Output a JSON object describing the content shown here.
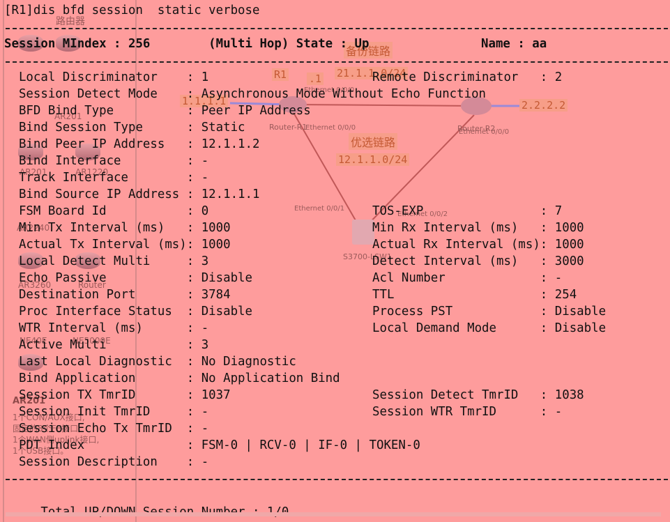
{
  "console": {
    "command_line": "[R1]dis bfd session  static verbose",
    "session_header": {
      "left": "Session MIndex : 256        (Multi Hop) State : Up",
      "right": "Name : aa"
    },
    "rows": [
      {
        "l": "  Local Discriminator    : 1",
        "r": "Remote Discriminator   : 2"
      },
      {
        "l": "  Session Detect Mode    : Asynchronous Mode Without Echo Function",
        "r": ""
      },
      {
        "l": "  BFD Bind Type          : Peer IP Address",
        "r": ""
      },
      {
        "l": "  Bind Session Type      : Static",
        "r": ""
      },
      {
        "l": "  Bind Peer IP Address   : 12.1.1.2",
        "r": ""
      },
      {
        "l": "  Bind Interface         : -",
        "r": ""
      },
      {
        "l": "  Track Interface        : -",
        "r": ""
      },
      {
        "l": "  Bind Source IP Address : 12.1.1.1",
        "r": ""
      },
      {
        "l": "  FSM Board Id           : 0",
        "r": "TOS-EXP                : 7"
      },
      {
        "l": "  Min Tx Interval (ms)   : 1000",
        "r": "Min Rx Interval (ms)   : 1000"
      },
      {
        "l": "  Actual Tx Interval (ms): 1000",
        "r": "Actual Rx Interval (ms): 1000"
      },
      {
        "l": "  Local Detect Multi     : 3",
        "r": "Detect Interval (ms)   : 3000"
      },
      {
        "l": "  Echo Passive           : Disable",
        "r": "Acl Number             : -"
      },
      {
        "l": "  Destination Port       : 3784",
        "r": "TTL                    : 254"
      },
      {
        "l": "  Proc Interface Status  : Disable",
        "r": "Process PST            : Disable"
      },
      {
        "l": "  WTR Interval (ms)      : -",
        "r": "Local Demand Mode      : Disable"
      },
      {
        "l": "  Active Multi           : 3",
        "r": ""
      },
      {
        "l": "  Last Local Diagnostic  : No Diagnostic",
        "r": ""
      },
      {
        "l": "  Bind Application       : No Application Bind",
        "r": ""
      },
      {
        "l": "  Session TX TmrID       : 1037",
        "r": "Session Detect TmrID   : 1038"
      },
      {
        "l": "  Session Init TmrID     : -",
        "r": "Session WTR TmrID      : -"
      },
      {
        "l": "  Session Echo Tx TmrID  : -",
        "r": ""
      },
      {
        "l": "  PDT Index              : FSM-0 | RCV-0 | IF-0 | TOKEN-0",
        "r": ""
      },
      {
        "l": "  Session Description    : -",
        "r": ""
      }
    ],
    "total_line": "     Total UP/DOWN Session Number : 1/0"
  },
  "background": {
    "sidebar_title": "路由器",
    "device_labels": [
      "AR201",
      "AR1220",
      "AR2240",
      "AR3260",
      "Router",
      "NE40E",
      "NE5000E",
      "AR201"
    ],
    "device_desc": [
      "1个CON/AUX接口,",
      "固定的8个FE接口,",
      "1个WAN侧uplink接口,",
      "1个USB接口。"
    ],
    "topology": {
      "link_backup_label": "备份链路",
      "link_preferred_label": "优选链路",
      "router_r1_label": "R1",
      "router_r1_name": "Router-R1",
      "router_r2_name": "Router-R2",
      "switch_name": "S3700-LSW1",
      "net_backup": "21.1.1.0/24",
      "net_preferred": "12.1.1.0/24",
      "addr_r1_lo": "1.1.1.1",
      "addr_r2_lo": "2.2.2.2",
      "addr_dot1": ".1",
      "ports": [
        "Ethernet 0/0/0",
        "Ethernet 0/0/0",
        "Ethernet 0/0/0",
        "Ethernet 0/0/1",
        "Ethernet 0/0/2"
      ]
    }
  },
  "colors": {
    "overlay": "#fe9c9c",
    "text": "#111111",
    "link_line": "#c05858"
  }
}
